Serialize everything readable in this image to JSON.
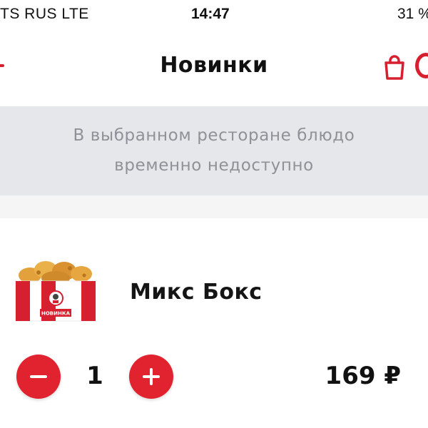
{
  "status_bar": {
    "carrier": "TS RUS   LTE",
    "time": "14:47",
    "battery": "31 %"
  },
  "header": {
    "title": "Новинки",
    "back_icon": "back-arrow-icon",
    "cart_icon": "shopping-bag-icon",
    "accent_color": "#d6202f"
  },
  "banner": {
    "line1": "В выбранном ресторане блюдо",
    "line2": "временно недоступно"
  },
  "product": {
    "name": "Микс Бокс",
    "badge": "НОВИНКА",
    "quantity": "1",
    "price": "169 ₽"
  },
  "colors": {
    "accent": "#e1222f",
    "banner_bg": "#e5e7ea",
    "banner_text": "#8e9298"
  }
}
